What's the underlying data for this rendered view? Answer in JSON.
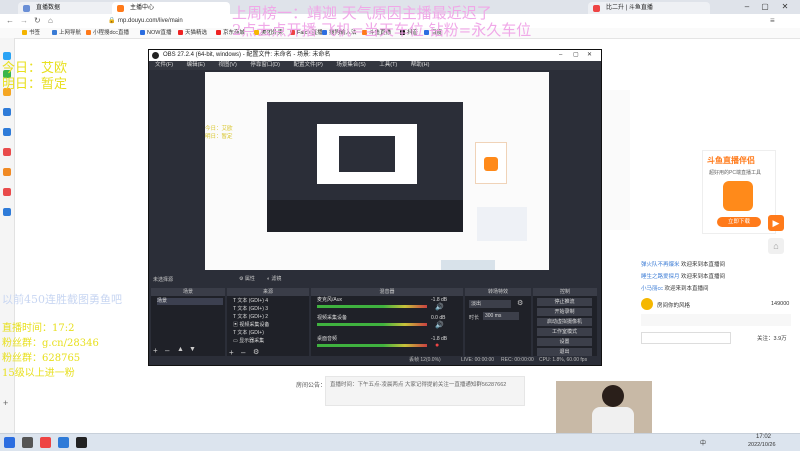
{
  "browser": {
    "tabs": [
      "直播数据",
      "主播中心",
      "比二升 | 斗鱼直播"
    ],
    "url": "mp.douyu.com/live/main",
    "bookmarks": [
      "书签",
      "上网导航",
      "小程搜dcc直播",
      "NOW直播",
      "天猫精选",
      "京东商城",
      "美团外卖",
      "Falchi直播",
      "搜狗输入法",
      "斗鱼直播",
      "抖音",
      "百度"
    ]
  },
  "overlay": {
    "banner_line1": "上周榜一：靖迦  天气原因主播最近迟了",
    "banner_line2": "2点去点开播  飞机=当天车位  钻粉=永久车位",
    "today": "今日：艾欧",
    "tomorrow": "明日：暂定",
    "slogan": "以前450连胜截图勇鱼吧",
    "info1": "直播时间：17:2",
    "info2": "粉丝群：g.cn/28346",
    "info3": "粉丝群：628765",
    "info4": "15级以上进一粉"
  },
  "obs": {
    "title": "OBS 27.2.4 (64-bit, windows) - 配置文件: 未命名 - 场景: 未命名",
    "menu": [
      "文件(F)",
      "编辑(E)",
      "视图(V)",
      "停靠窗口(D)",
      "配置文件(P)",
      "场景集合(S)",
      "工具(T)",
      "帮助(H)"
    ],
    "preview_today": "今日：艾欧",
    "preview_tomorrow": "明日：暂定",
    "no_source": "未选择源",
    "props_label": "属性",
    "filter_label": "滤镜",
    "scenes_header": "场景",
    "sources_header": "来源",
    "mixer_header": "混音器",
    "transition_header": "转场特效",
    "controls_header": "控制",
    "scene_item": "场景",
    "sources": [
      "文本 (GDI+) 4",
      "文本 (GDI+) 3",
      "文本 (GDI+) 2",
      "视频采集设备",
      "文本 (GDI+)",
      "显示器采集"
    ],
    "mixer": [
      {
        "name": "麦克风/Aux",
        "db": "-1.8 dB"
      },
      {
        "name": "视频采集设备",
        "db": "0.0 dB"
      },
      {
        "name": "桌面音频",
        "db": "-1.8 dB"
      }
    ],
    "transition": {
      "type": "淡出",
      "duration_label": "时长",
      "duration": "300 ms"
    },
    "controls": [
      "停止推流",
      "开始录制",
      "启动虚拟摄像机",
      "工作室模式",
      "设置",
      "退出"
    ],
    "status": {
      "drop": "丢帧 12(0.0%)",
      "live": "LIVE: 00:00:00",
      "rec": "REC: 00:00:00",
      "cpu": "CPU: 1.8%, 60.00 fps"
    }
  },
  "douyu": {
    "promo_title": "斗鱼直播伴侣",
    "promo_sub": "超好用的PC端直播工具",
    "promo_button": "立即下载",
    "chat": [
      "欢迎来到本直播间",
      "欢迎来到本直播间",
      "欢迎来到本直播间"
    ],
    "chat_users": [
      "弹火队不再爆米",
      "睡生之路爱探月",
      "小马丽cc"
    ],
    "gift_title": "房间你的风格",
    "gift_count": "149000",
    "follow": "关注：3.9万",
    "notice_label": "房间公告：",
    "notice_text": "直播时间：下午五点-凌晨两点 大家记得提前关注一直播通知群56287662"
  },
  "taskbar": {
    "time": "17:02",
    "date": "2022/10/26",
    "lang": "中"
  }
}
